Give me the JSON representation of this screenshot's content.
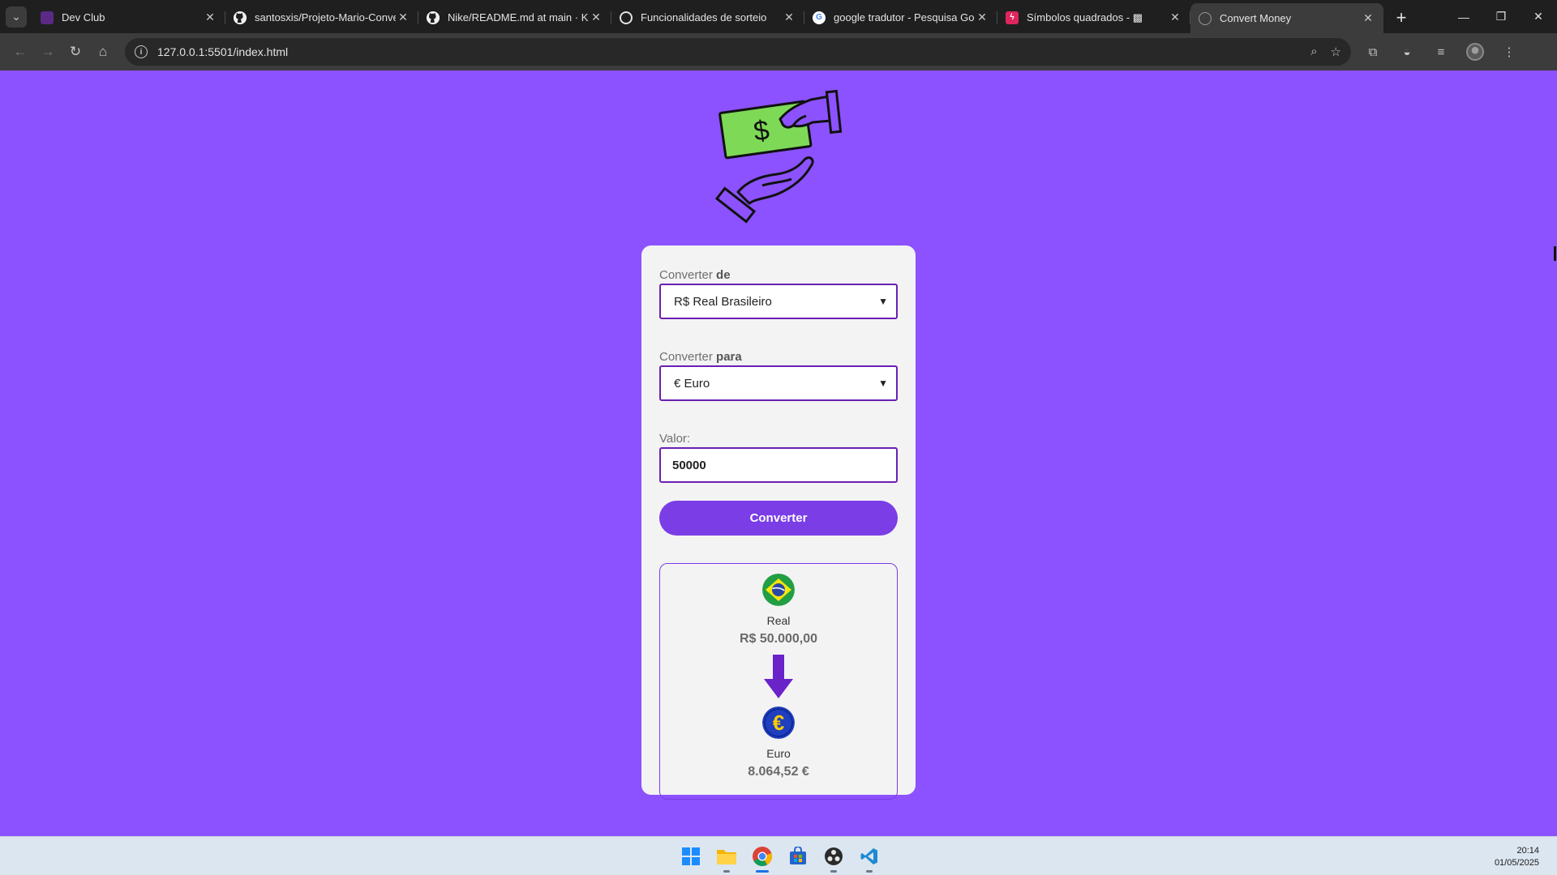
{
  "browser": {
    "tabs": [
      {
        "title": "Dev Club",
        "favicon": "devclub-icon"
      },
      {
        "title": "santosxis/Projeto-Mario-Conve",
        "favicon": "github-icon"
      },
      {
        "title": "Nike/README.md at main · Ka",
        "favicon": "github-icon"
      },
      {
        "title": "Funcionalidades de sorteio",
        "favicon": "openai-icon"
      },
      {
        "title": "google tradutor - Pesquisa Goo",
        "favicon": "google-icon"
      },
      {
        "title": "Símbolos quadrados - ▩",
        "favicon": "bolt-icon"
      },
      {
        "title": "Convert Money",
        "favicon": "globe-icon"
      }
    ],
    "url": "127.0.0.1:5501/index.html"
  },
  "converter": {
    "from_label": "Converter",
    "from_label_bold": "de",
    "from_value": "R$ Real Brasileiro",
    "to_label": "Converter",
    "to_label_bold": "para",
    "to_value": "€ Euro",
    "amount_label": "Valor:",
    "amount_value": "50000",
    "button_label": "Converter",
    "result": {
      "from_name": "Real",
      "from_amount": "R$ 50.000,00",
      "to_name": "Euro",
      "to_amount": "8.064,52 €"
    }
  },
  "taskbar": {
    "time": "20:14",
    "date": "01/05/2025",
    "apps": [
      "windows-start-icon",
      "file-explorer-icon",
      "chrome-icon",
      "microsoft-store-icon",
      "obs-icon",
      "vscode-icon"
    ]
  },
  "colors": {
    "page_background": "#8c52ff",
    "accent": "#7a3de6",
    "card": "#f3f3f3",
    "money_green": "#7ed957"
  }
}
